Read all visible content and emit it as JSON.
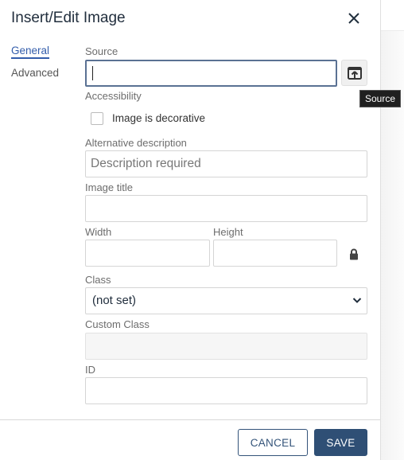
{
  "dialog": {
    "title": "Insert/Edit Image",
    "close_icon": "close-icon"
  },
  "tabs": [
    {
      "label": "General",
      "active": true
    },
    {
      "label": "Advanced",
      "active": false
    }
  ],
  "fields": {
    "source": {
      "label": "Source",
      "value": "",
      "browse_icon": "browse-upload-icon",
      "tooltip": "Source"
    },
    "accessibility": {
      "label": "Accessibility",
      "checkbox_label": "Image is decorative",
      "checked": false
    },
    "alt": {
      "label": "Alternative description",
      "placeholder": "Description required",
      "value": ""
    },
    "title": {
      "label": "Image title",
      "value": ""
    },
    "width": {
      "label": "Width",
      "value": ""
    },
    "height": {
      "label": "Height",
      "value": ""
    },
    "lock_icon": "lock-icon",
    "class": {
      "label": "Class",
      "selected": "(not set)"
    },
    "custom_class": {
      "label": "Custom Class",
      "value": ""
    },
    "id": {
      "label": "ID",
      "value": ""
    }
  },
  "footer": {
    "cancel_label": "CANCEL",
    "save_label": "SAVE"
  },
  "colors": {
    "accent": "#335dab",
    "primary_button": "#2f4f75",
    "focus_border": "#5a7193"
  }
}
